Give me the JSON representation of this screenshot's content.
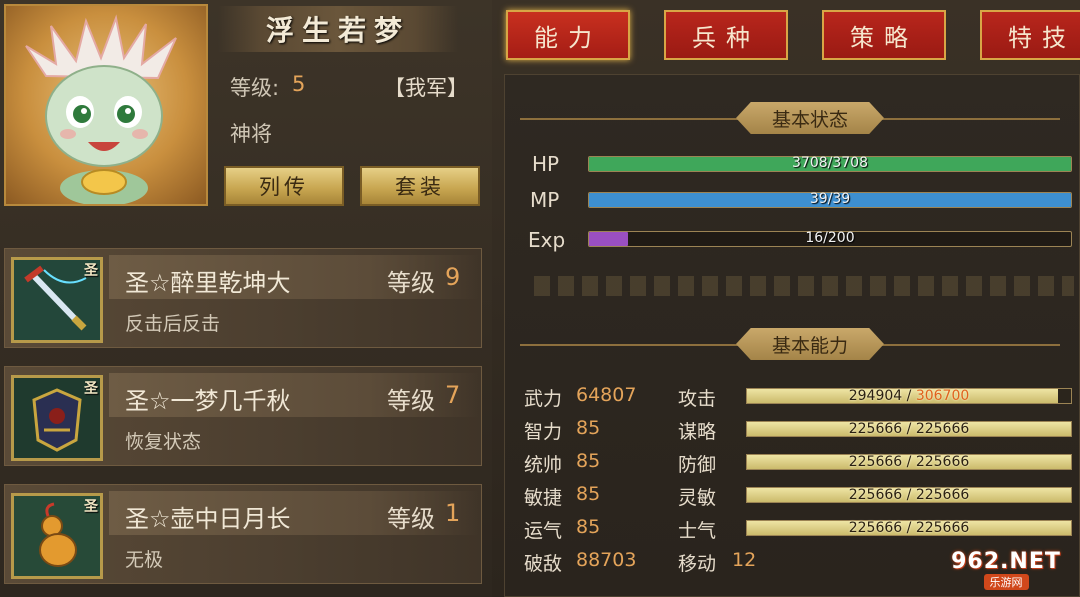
{
  "hero": {
    "name": "浮生若梦",
    "level_label": "等级:",
    "level_value": "5",
    "faction": "【我军】",
    "rank": "神将",
    "buttons": {
      "biography": "列传",
      "outfit": "套装"
    }
  },
  "tabs": [
    "能力",
    "兵种",
    "策略",
    "特技"
  ],
  "skills": [
    {
      "name": "圣☆醉里乾坤大",
      "level_label": "等级",
      "level_value": "9",
      "desc": "反击后反击",
      "tag": "圣",
      "icon": "sword-icon"
    },
    {
      "name": "圣☆一梦几千秋",
      "level_label": "等级",
      "level_value": "7",
      "desc": "恢复状态",
      "tag": "圣",
      "icon": "armor-icon"
    },
    {
      "name": "圣☆壶中日月长",
      "level_label": "等级",
      "level_value": "1",
      "desc": "无极",
      "tag": "圣",
      "icon": "gourd-icon"
    }
  ],
  "status": {
    "title": "基本状态",
    "hp": {
      "label": "HP",
      "text": "3708/3708",
      "current": 3708,
      "max": 3708,
      "color": "#3fa75a"
    },
    "mp": {
      "label": "MP",
      "text": "39/39",
      "current": 39,
      "max": 39,
      "color": "#3d8fd0"
    },
    "exp": {
      "label": "Exp",
      "text": "16/200",
      "current": 16,
      "max": 200,
      "color": "#9a4fc1"
    }
  },
  "ability": {
    "title": "基本能力",
    "attributes": [
      {
        "label": "武力",
        "value": "64807"
      },
      {
        "label": "智力",
        "value": "85"
      },
      {
        "label": "统帅",
        "value": "85"
      },
      {
        "label": "敏捷",
        "value": "85"
      },
      {
        "label": "运气",
        "value": "85"
      },
      {
        "label": "破敌",
        "value": "88703"
      }
    ],
    "stats": [
      {
        "label": "攻击",
        "current": "294904",
        "sep": " / ",
        "max": "306700",
        "highlight": true,
        "fraction": 0.96
      },
      {
        "label": "谋略",
        "current": "225666",
        "sep": " / ",
        "max": "225666",
        "highlight": false,
        "fraction": 1.0
      },
      {
        "label": "防御",
        "current": "225666",
        "sep": " / ",
        "max": "225666",
        "highlight": false,
        "fraction": 1.0
      },
      {
        "label": "灵敏",
        "current": "225666",
        "sep": " / ",
        "max": "225666",
        "highlight": false,
        "fraction": 1.0
      },
      {
        "label": "士气",
        "current": "225666",
        "sep": " / ",
        "max": "225666",
        "highlight": false,
        "fraction": 1.0
      }
    ],
    "move_label": "移动",
    "move_value": "12"
  },
  "watermark": {
    "main": "962.NET",
    "sub": "乐游网"
  }
}
